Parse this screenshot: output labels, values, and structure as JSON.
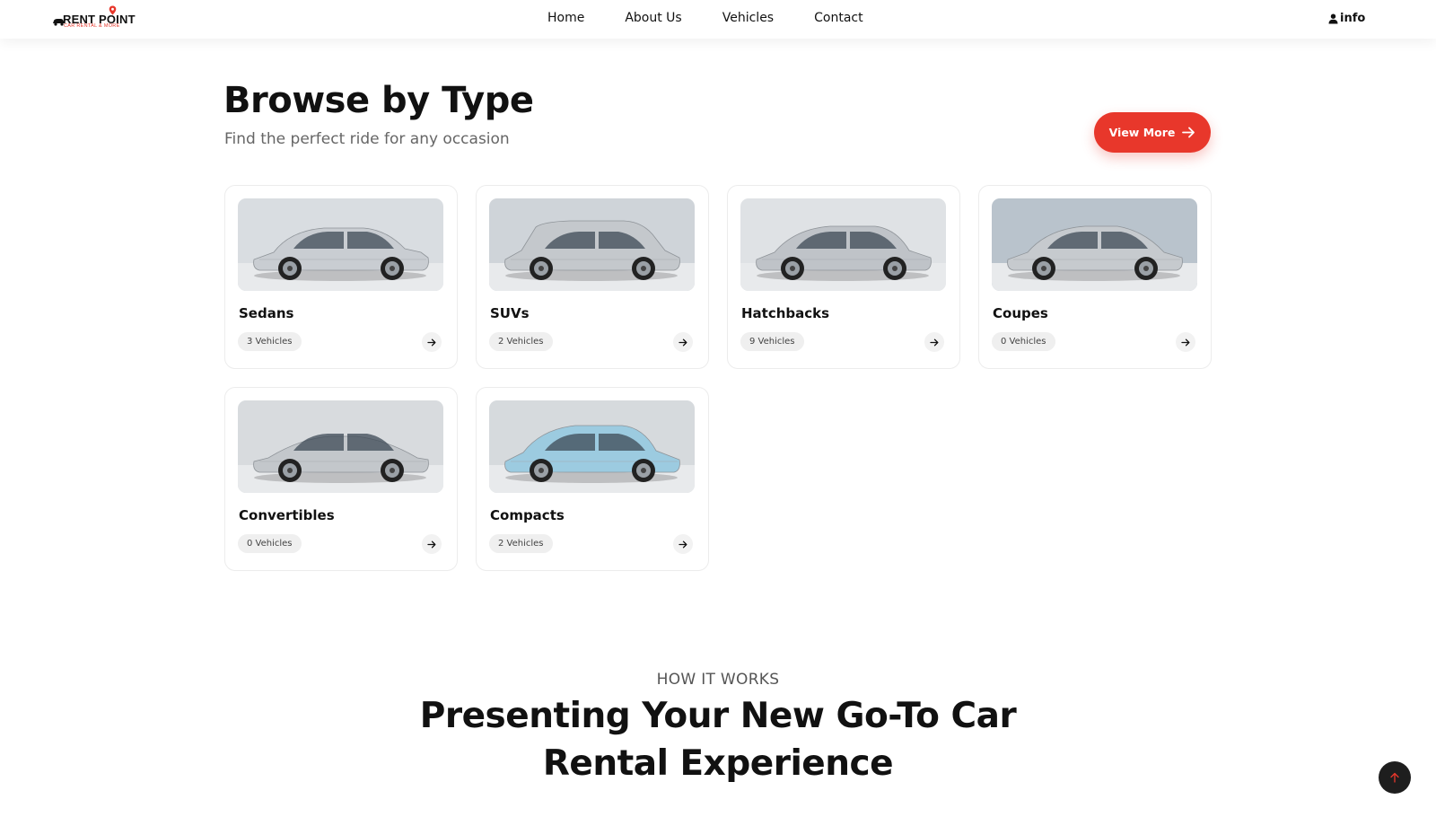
{
  "brand": {
    "name": "RENT POINT",
    "tagline": "CAR RENTAL & MORE",
    "accent": "#e8372b"
  },
  "nav": {
    "items": [
      "Home",
      "About Us",
      "Vehicles",
      "Contact"
    ],
    "user_label": "info",
    "user_icon": "user-icon"
  },
  "browse": {
    "title": "Browse by Type",
    "subtitle": "Find the perfect ride for any occasion",
    "view_more_label": "View More",
    "categories": [
      {
        "name": "Sedans",
        "count": "3 Vehicles",
        "body": "sedan",
        "car_color": "#c9cdd2",
        "bg": "#d9dde1"
      },
      {
        "name": "SUVs",
        "count": "2 Vehicles",
        "body": "suv",
        "car_color": "#c4c8cc",
        "bg": "#cfd4d9"
      },
      {
        "name": "Hatchbacks",
        "count": "9 Vehicles",
        "body": "hatch",
        "car_color": "#bfc3c8",
        "bg": "#dfe2e5"
      },
      {
        "name": "Coupes",
        "count": "0 Vehicles",
        "body": "coupe",
        "car_color": "#c6cace",
        "bg": "#b9c3cc"
      },
      {
        "name": "Convertibles",
        "count": "0 Vehicles",
        "body": "sport",
        "car_color": "#c3c7cb",
        "bg": "#d8dbde"
      },
      {
        "name": "Compacts",
        "count": "2 Vehicles",
        "body": "compact",
        "car_color": "#9ccbe0",
        "bg": "#d6dadd"
      }
    ]
  },
  "how_it_works": {
    "label": "HOW IT WORKS",
    "title_line1": "Presenting Your New Go-To Car",
    "title_line2": "Rental Experience"
  },
  "colors": {
    "text": "#111111",
    "muted": "#666666",
    "scroll_button": "#1e1e1e"
  }
}
